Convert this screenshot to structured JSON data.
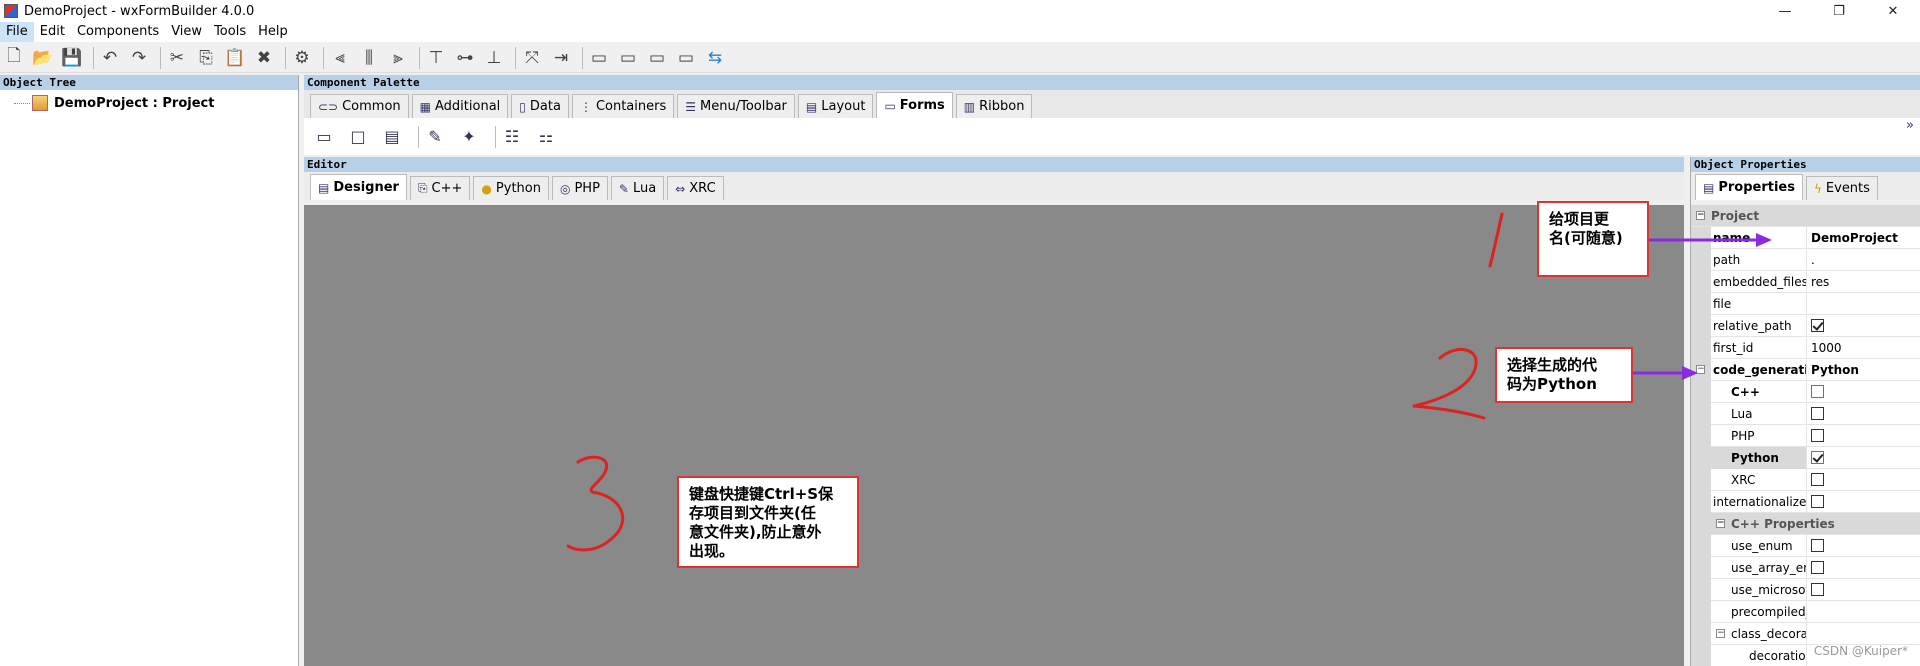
{
  "window": {
    "title": "DemoProject - wxFormBuilder 4.0.0",
    "minimize": "—",
    "restore": "❐",
    "close": "✕"
  },
  "menu": {
    "items": [
      "File",
      "Edit",
      "Components",
      "View",
      "Tools",
      "Help"
    ]
  },
  "object_tree": {
    "header": "Object Tree",
    "root_label": "DemoProject : Project"
  },
  "palette": {
    "header": "Component Palette",
    "tabs": [
      "Common",
      "Additional",
      "Data",
      "Containers",
      "Menu/Toolbar",
      "Layout",
      "Forms",
      "Ribbon"
    ],
    "active_tab": "Forms",
    "more": "»"
  },
  "editor": {
    "header": "Editor",
    "tabs": [
      "Designer",
      "C++",
      "Python",
      "PHP",
      "Lua",
      "XRC"
    ],
    "active_tab": "Designer"
  },
  "properties": {
    "header": "Object Properties",
    "tabs": [
      "Properties",
      "Events"
    ],
    "active_tab": "Properties",
    "category_project": "Project",
    "category_cpp": "C++ Properties",
    "rows": {
      "name": {
        "label": "name",
        "value": "DemoProject"
      },
      "path": {
        "label": "path",
        "value": "."
      },
      "embedded_files": {
        "label": "embedded_files_path",
        "value": "res"
      },
      "file": {
        "label": "file",
        "value": ""
      },
      "relative_path": {
        "label": "relative_path"
      },
      "first_id": {
        "label": "first_id",
        "value": "1000"
      },
      "code_generation": {
        "label": "code_generation",
        "value": "Python"
      },
      "cpp": {
        "label": "C++"
      },
      "lua": {
        "label": "Lua"
      },
      "php": {
        "label": "PHP"
      },
      "python": {
        "label": "Python"
      },
      "xrc": {
        "label": "XRC"
      },
      "internationalize": {
        "label": "internationalize"
      },
      "use_enum": {
        "label": "use_enum"
      },
      "use_array_enum": {
        "label": "use_array_enum"
      },
      "use_microsoft": {
        "label": "use_microsoft_bom"
      },
      "precompiled": {
        "label": "precompiled_header",
        "value": ""
      },
      "class_decoration": {
        "label": "class_decoration"
      },
      "decoration": {
        "label": "decoration",
        "value": ""
      }
    }
  },
  "annotations": {
    "callout1": "给项目更\n名(可随意)",
    "callout2": "选择生成的代\n码为Python",
    "callout3": "键盘快捷键Ctrl+S保\n存项目到文件夹(任\n意文件夹),防止意外\n出现。"
  },
  "watermark": "CSDN @Kuiper*",
  "colors": {
    "annotation_red": "#dd2222",
    "arrow_purple": "#8a2be2",
    "canvas_gray": "#898989",
    "panel_header_blue": "#b8cfe8"
  }
}
